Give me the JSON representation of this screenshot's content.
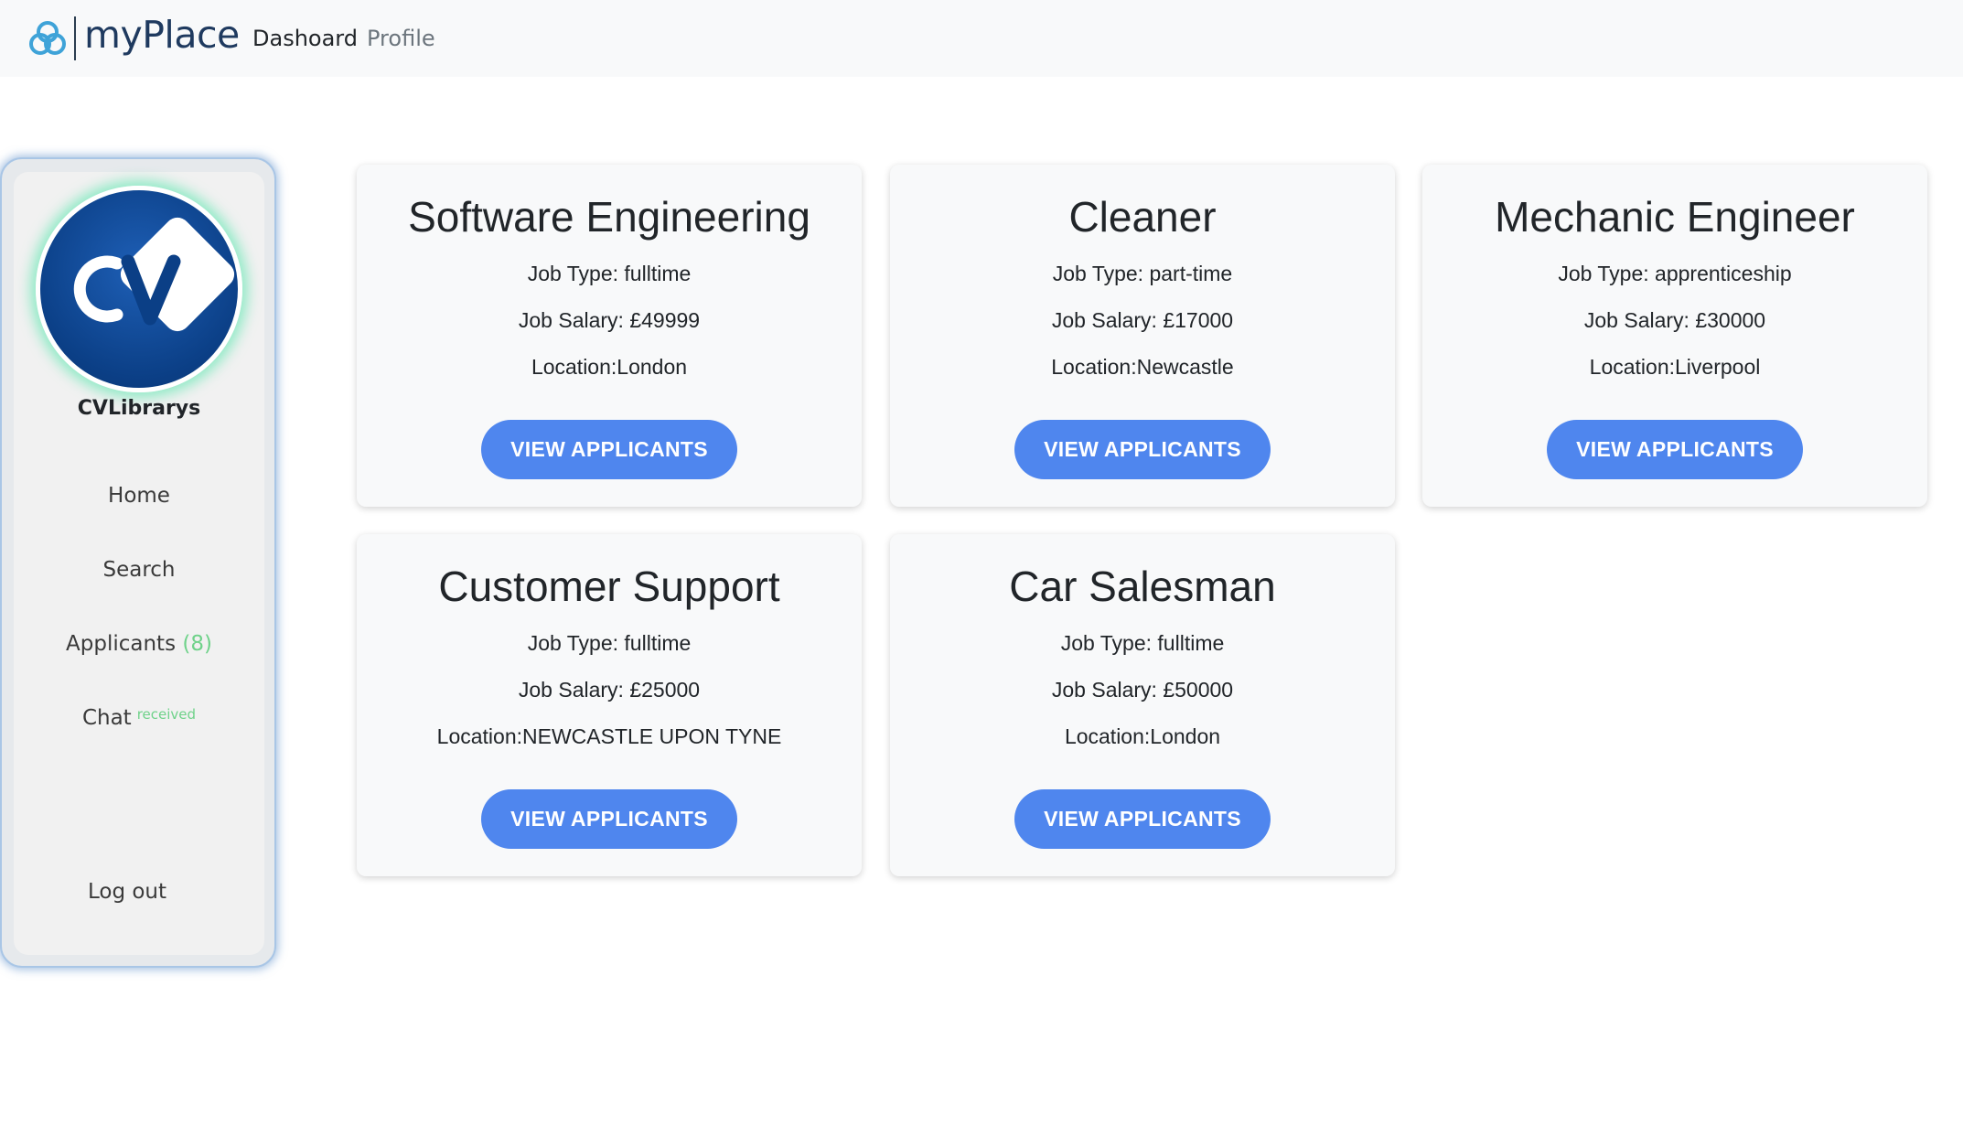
{
  "header": {
    "brand": "myPlace",
    "nav": [
      {
        "label": "Dashoard",
        "active": true
      },
      {
        "label": "Profile",
        "active": false
      }
    ],
    "logo_icon": "triquetra-logo-icon"
  },
  "sidebar": {
    "company_name": "CVLibrarys",
    "avatar_text": "CV",
    "items": {
      "home": "Home",
      "search": "Search",
      "applicants": "Applicants",
      "applicants_count": "(8)",
      "chat": "Chat",
      "chat_status": "received",
      "logout": "Log out"
    }
  },
  "jobs": [
    {
      "title": "Software Engineering",
      "type": "Job Type: fulltime",
      "salary": "Job Salary: £49999",
      "location": "Location:London",
      "button": "VIEW APPLICANTS"
    },
    {
      "title": "Cleaner",
      "type": "Job Type: part-time",
      "salary": "Job Salary: £17000",
      "location": "Location:Newcastle",
      "button": "VIEW APPLICANTS"
    },
    {
      "title": "Mechanic Engineer",
      "type": "Job Type: apprenticeship",
      "salary": "Job Salary: £30000",
      "location": "Location:Liverpool",
      "button": "VIEW APPLICANTS"
    },
    {
      "title": "Customer Support",
      "type": "Job Type: fulltime",
      "salary": "Job Salary: £25000",
      "location": "Location:NEWCASTLE UPON TYNE",
      "button": "VIEW APPLICANTS"
    },
    {
      "title": "Car Salesman",
      "type": "Job Type: fulltime",
      "salary": "Job Salary: £50000",
      "location": "Location:London",
      "button": "VIEW APPLICANTS"
    }
  ],
  "colors": {
    "accent_button": "#4f86ee",
    "badge_green": "#6fd28a",
    "avatar_blue": "#0b3f86"
  }
}
